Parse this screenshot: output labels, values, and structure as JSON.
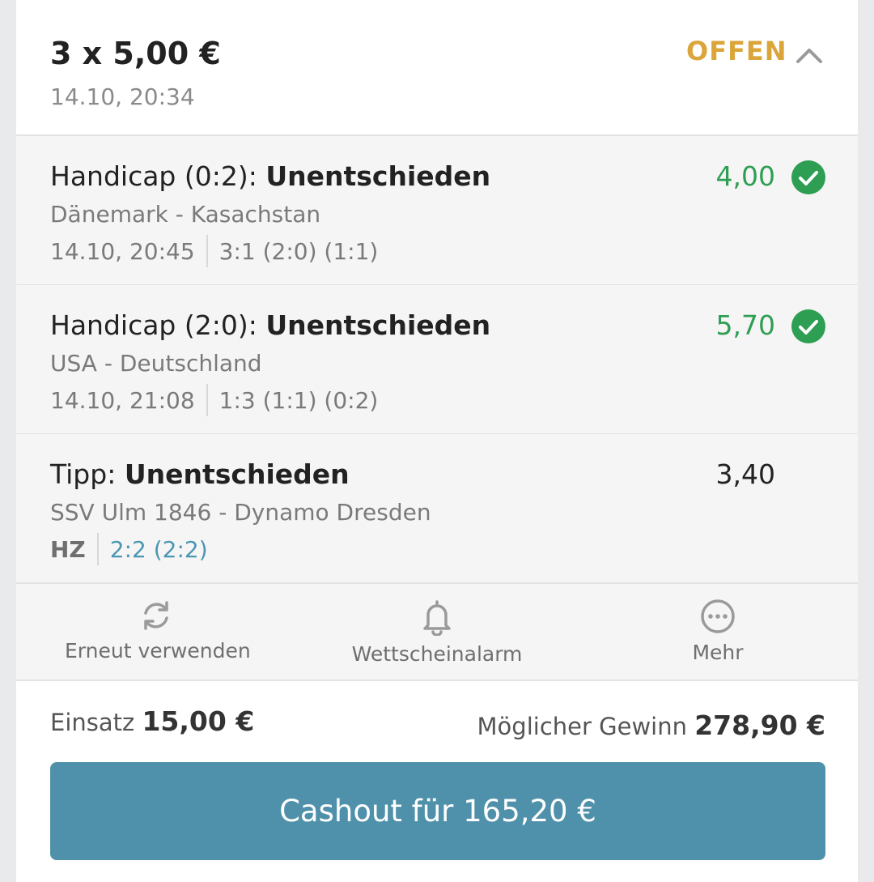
{
  "bet": {
    "title": "3 x 5,00 €",
    "date": "14.10, 20:34",
    "status": "OFFEN",
    "status_color": "#dba53a"
  },
  "legs": [
    {
      "market_prefix": "Handicap (0:2): ",
      "selection": "Unentschieden",
      "match": "Dänemark - Kasachstan",
      "time": "14.10, 20:45",
      "score": "3:1 (2:0) (1:1)",
      "odds": "4,00",
      "result_icon": "check-circle-icon"
    },
    {
      "market_prefix": "Handicap (2:0): ",
      "selection": "Unentschieden",
      "match": "USA - Deutschland",
      "time": "14.10, 21:08",
      "score": "1:3 (1:1) (0:2)",
      "odds": "5,70",
      "result_icon": "check-circle-icon"
    },
    {
      "market_prefix": "Tipp: ",
      "selection": "Unentschieden",
      "match": "SSV Ulm 1846 - Dynamo Dresden",
      "time": "HZ",
      "score": "2:2 (2:2)",
      "odds": "3,40"
    }
  ],
  "actions": [
    {
      "label": "Erneut verwenden",
      "icon": "refresh-icon"
    },
    {
      "label": "Wettscheinalarm",
      "icon": "bell-icon"
    },
    {
      "label": "Mehr",
      "icon": "more-icon"
    }
  ],
  "footer": {
    "stake_label": "Einsatz",
    "stake_value": "15,00 €",
    "win_label": "Möglicher Gewinn",
    "win_value": "278,90 €",
    "cashout_label": "Cashout für 165,20 €"
  },
  "colors": {
    "won": "#2e9e53",
    "live_score": "#4a97b4",
    "cashout_button": "#4f91aa"
  }
}
